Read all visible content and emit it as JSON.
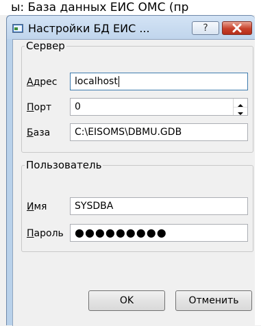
{
  "background_title": "ы: База данных ЕИС ОМС (пр",
  "window": {
    "title": "Настройки БД ЕИС ...",
    "help_label": "?"
  },
  "server_group": {
    "legend": "Сервер",
    "address": {
      "label_first": "А",
      "label_rest": "дрес",
      "value": "localhost"
    },
    "port": {
      "label_first": "П",
      "label_rest": "орт",
      "value": "0"
    },
    "database": {
      "label_first": "Б",
      "label_rest": "аза",
      "value": "C:\\EISOMS\\DBMU.GDB"
    }
  },
  "user_group": {
    "legend": "Пользователь",
    "name": {
      "label_first": "И",
      "label_rest": "мя",
      "value": "SYSDBA"
    },
    "password": {
      "label_first": "П",
      "label_rest": "ароль",
      "masked": "●●●●●●●●●"
    }
  },
  "buttons": {
    "ok": "OK",
    "cancel": "Отменить"
  }
}
